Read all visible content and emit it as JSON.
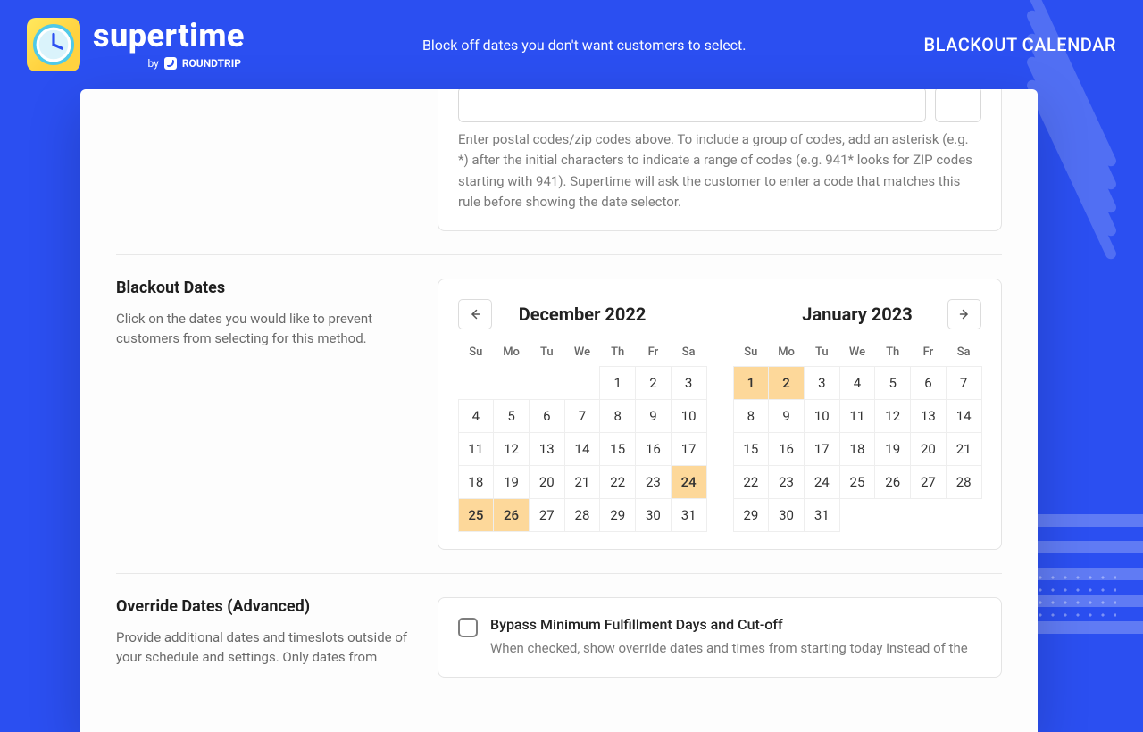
{
  "brand": {
    "name": "supertime",
    "by_prefix": "by",
    "by_label": "ROUNDTRIP"
  },
  "header": {
    "tagline": "Block off dates you don't want customers to select.",
    "page_title": "BLACKOUT CALENDAR"
  },
  "postal": {
    "help": "Enter postal codes/zip codes above. To include a group of codes, add an asterisk (e.g. *) after the initial characters to indicate a range of codes (e.g. 941* looks for ZIP codes starting with 941). Supertime will ask the customer to enter a code that matches this rule before showing the date selector."
  },
  "blackout": {
    "title": "Blackout Dates",
    "desc": "Click on the dates you would like to prevent customers from selecting for this method.",
    "dow": [
      "Su",
      "Mo",
      "Tu",
      "We",
      "Th",
      "Fr",
      "Sa"
    ],
    "months": [
      {
        "title": "December 2022",
        "lead_blanks": 4,
        "days": 31,
        "picked": [
          24,
          25,
          26
        ]
      },
      {
        "title": "January 2023",
        "lead_blanks": 0,
        "days": 31,
        "picked": [
          1,
          2
        ]
      }
    ]
  },
  "override": {
    "title": "Override Dates (Advanced)",
    "desc": "Provide additional dates and timeslots outside of your schedule and settings. Only dates from",
    "bypass_title": "Bypass Minimum Fulfillment Days and Cut-off",
    "bypass_desc": "When checked, show override dates and times from starting today instead of the"
  }
}
